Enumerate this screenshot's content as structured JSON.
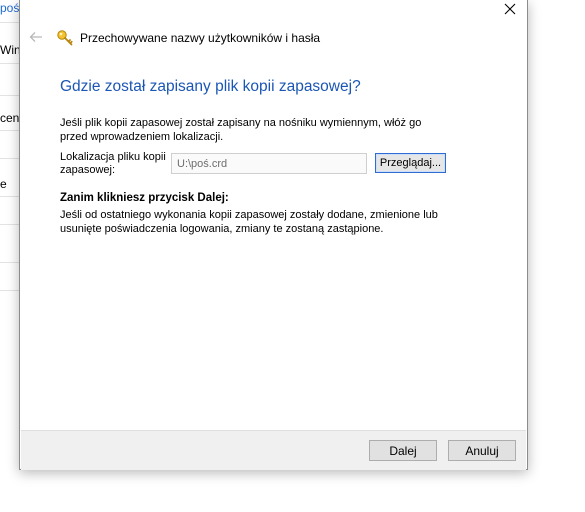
{
  "background_window": {
    "fragments": [
      "poświ",
      "Wind",
      "cen",
      "e"
    ]
  },
  "header": {
    "title": "Przechowywane nazwy użytkowników i hasła"
  },
  "main": {
    "heading": "Gdzie został zapisany plik kopii zapasowej?",
    "info": "Jeśli plik kopii zapasowej został zapisany na nośniku wymiennym, włóż go przed wprowadzeniem lokalizacji.",
    "location_label": "Lokalizacja pliku kopii zapasowej:",
    "location_value": "U:\\poś.crd",
    "browse_label": "Przeglądaj...",
    "warning_title": "Zanim klikniesz przycisk Dalej:",
    "warning_text": "Jeśli od ostatniego wykonania kopii zapasowej zostały dodane, zmienione lub usunięte poświadczenia logowania, zmiany te zostaną zastąpione."
  },
  "footer": {
    "next_label": "Dalej",
    "cancel_label": "Anuluj"
  },
  "icons": {
    "close": "close-icon",
    "back": "back-arrow-icon",
    "key": "key-icon"
  },
  "colors": {
    "heading": "#1b56b4",
    "link": "#1e6bd6"
  }
}
